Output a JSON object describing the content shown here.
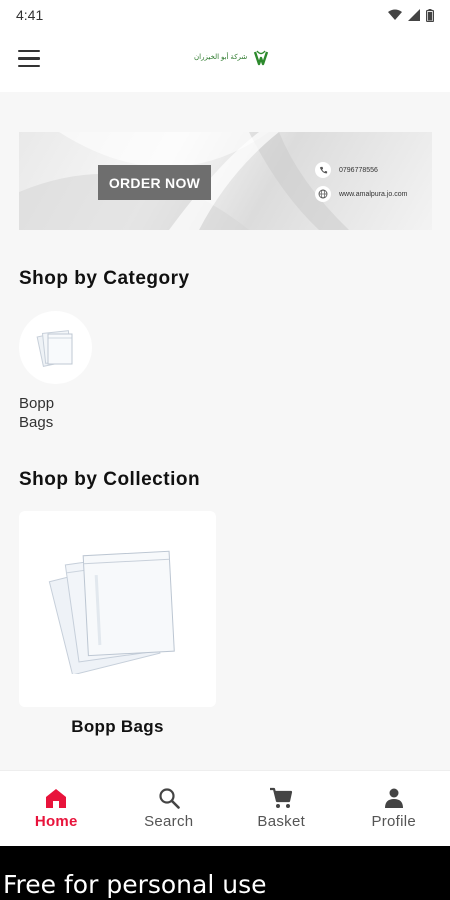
{
  "status_bar": {
    "time": "4:41"
  },
  "app_bar": {
    "logo_text_line1": "شركة أبو الخيزران"
  },
  "banner": {
    "order_label": "ORDER NOW",
    "phone": "0796778556",
    "website": "www.amalpura.jo.com"
  },
  "category_section": {
    "title": "Shop by Category",
    "items": [
      {
        "label": "Bopp Bags"
      }
    ]
  },
  "collection_section": {
    "title": "Shop by Collection",
    "items": [
      {
        "label": "Bopp Bags"
      }
    ]
  },
  "bottom_nav": {
    "items": [
      {
        "label": "Home",
        "icon": "home-icon",
        "active": true
      },
      {
        "label": "Search",
        "icon": "search-icon",
        "active": false
      },
      {
        "label": "Basket",
        "icon": "cart-icon",
        "active": false
      },
      {
        "label": "Profile",
        "icon": "person-icon",
        "active": false
      }
    ]
  },
  "watermark": "Free for personal use",
  "colors": {
    "accent": "#e8133b",
    "banner_button": "#6e6e6e"
  }
}
